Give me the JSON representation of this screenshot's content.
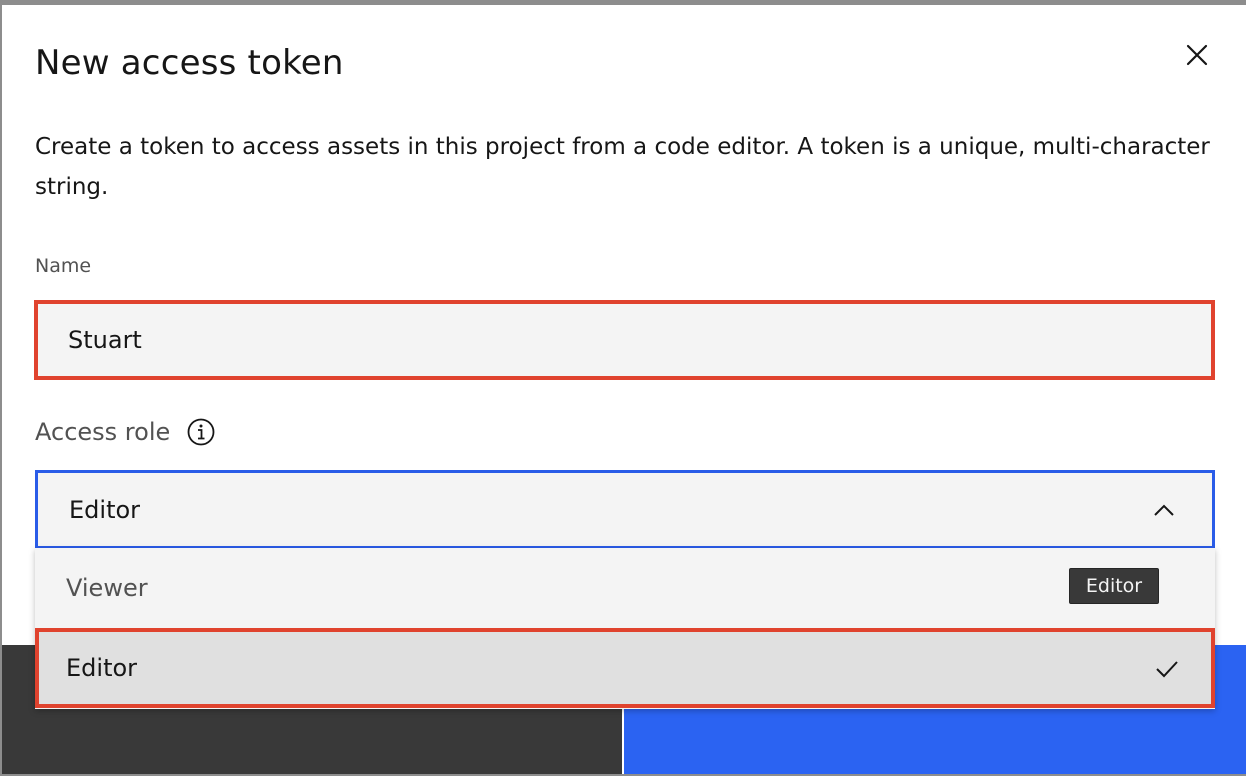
{
  "dialog": {
    "title": "New access token",
    "description": "Create a token to access assets in this project from a code editor. A token is a unique, multi-character string."
  },
  "name_field": {
    "label": "Name",
    "value": "Stuart"
  },
  "access_role": {
    "label": "Access role",
    "selected": "Editor",
    "options": [
      "Viewer",
      "Editor"
    ],
    "tooltip": "Editor"
  },
  "colors": {
    "highlight": "#e0432e",
    "focus": "#2a5ce8",
    "primary_button": "#2b63f2",
    "secondary_button": "#393939"
  },
  "icons": {
    "close": "close-icon",
    "info": "info-icon",
    "chevron": "chevron-up-icon",
    "check": "checkmark-icon"
  }
}
